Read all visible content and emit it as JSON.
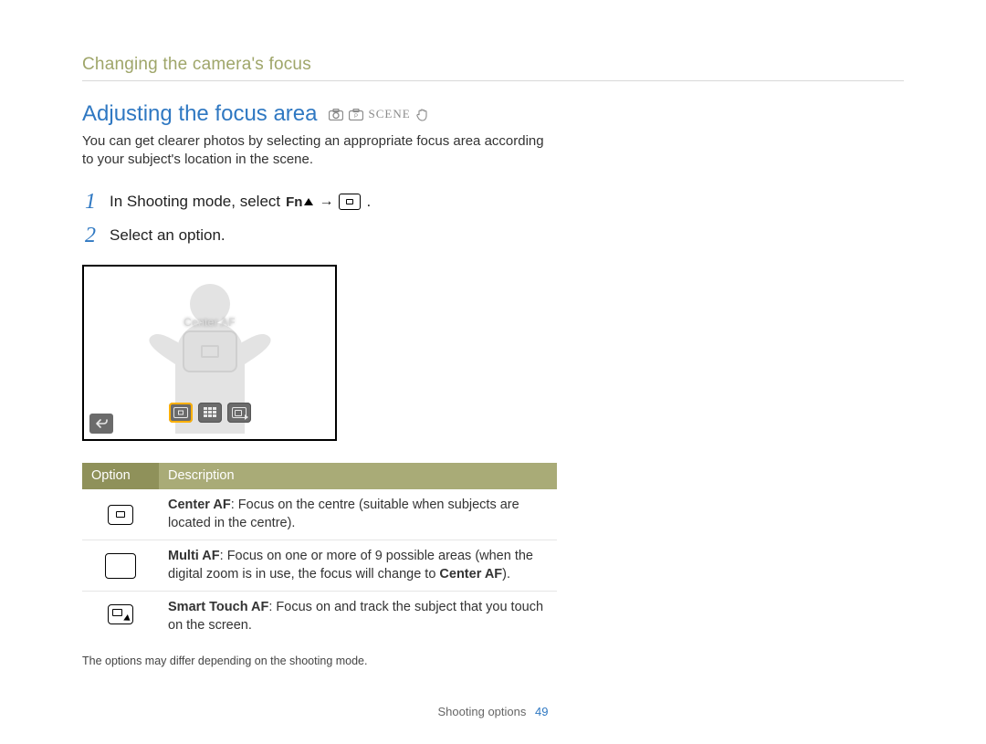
{
  "breadcrumb": "Changing the camera's focus",
  "heading": "Adjusting the focus area",
  "mode_icons": {
    "auto": "camera-auto-icon",
    "program": "camera-p-icon",
    "scene_label": "SCENE",
    "dual_is": "hand-icon"
  },
  "intro": "You can get clearer photos by selecting an appropriate focus area according to your subject's location in the scene.",
  "steps": [
    {
      "num": "1",
      "text_before": "In Shooting mode, select",
      "fn_label": "Fn",
      "arrow": "→",
      "text_after": "."
    },
    {
      "num": "2",
      "text": "Select an option."
    }
  ],
  "screenshot": {
    "selected_label": "Center AF",
    "options": [
      "center-af",
      "multi-af",
      "smart-touch-af"
    ],
    "back_label": "back"
  },
  "table": {
    "headers": {
      "option": "Option",
      "description": "Description"
    },
    "rows": [
      {
        "icon": "center-af",
        "name": "Center AF",
        "desc": ": Focus on the centre (suitable when subjects are located in the centre)."
      },
      {
        "icon": "multi-af",
        "name": "Multi AF",
        "desc_before": ": Focus on one or more of 9 possible areas (when the digital zoom is in use, the focus will change to ",
        "desc_bold": "Center AF",
        "desc_after": ")."
      },
      {
        "icon": "smart-touch-af",
        "name": "Smart Touch AF",
        "desc": ": Focus on and track the subject that you touch on the screen."
      }
    ]
  },
  "footnote": "The options may differ depending on the shooting mode.",
  "footer": {
    "section": "Shooting options",
    "page": "49"
  }
}
